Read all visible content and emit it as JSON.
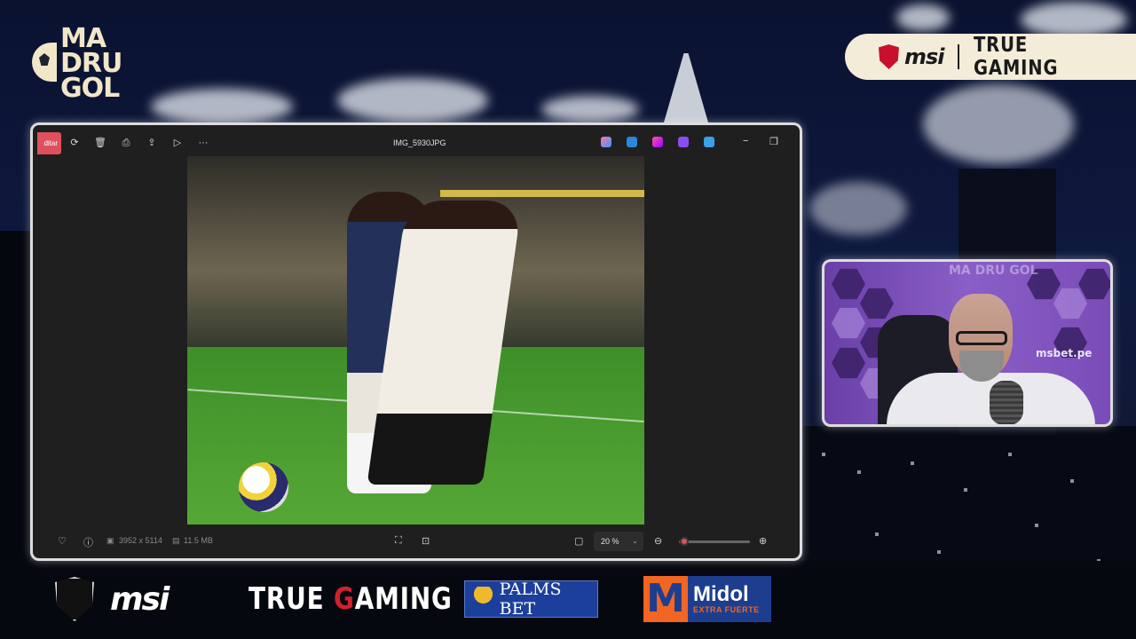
{
  "logo": {
    "lines": [
      "MA",
      "DRU",
      "GOL"
    ]
  },
  "top_sponsor": {
    "brand": "msi",
    "tagline": "TRUE GAMING"
  },
  "viewer": {
    "edit_label": "ditar",
    "filename": "IMG_5930JPG",
    "dimensions": "3952 x 5114",
    "file_size": "11.5 MB",
    "zoom": "20 %",
    "zoom_fraction": 0.08
  },
  "cam": {
    "brand_text": "MA DRU GOL",
    "sponsor_text": "msbet.pe"
  },
  "bottom_sponsors": {
    "msi_word": "msi",
    "true_gaming": [
      "TRUE ",
      "G",
      "AMING"
    ],
    "palms_bet": "PALMS BET",
    "midol_letter": "M",
    "midol_name": "Midol",
    "midol_sub": "EXTRA FUERTE"
  },
  "colors": {
    "accent": "#e0505c",
    "logo_cream": "#f2e6c8",
    "msi_red": "#c8102e",
    "palms_blue": "#1b3f9a",
    "midol_orange": "#f26522"
  }
}
